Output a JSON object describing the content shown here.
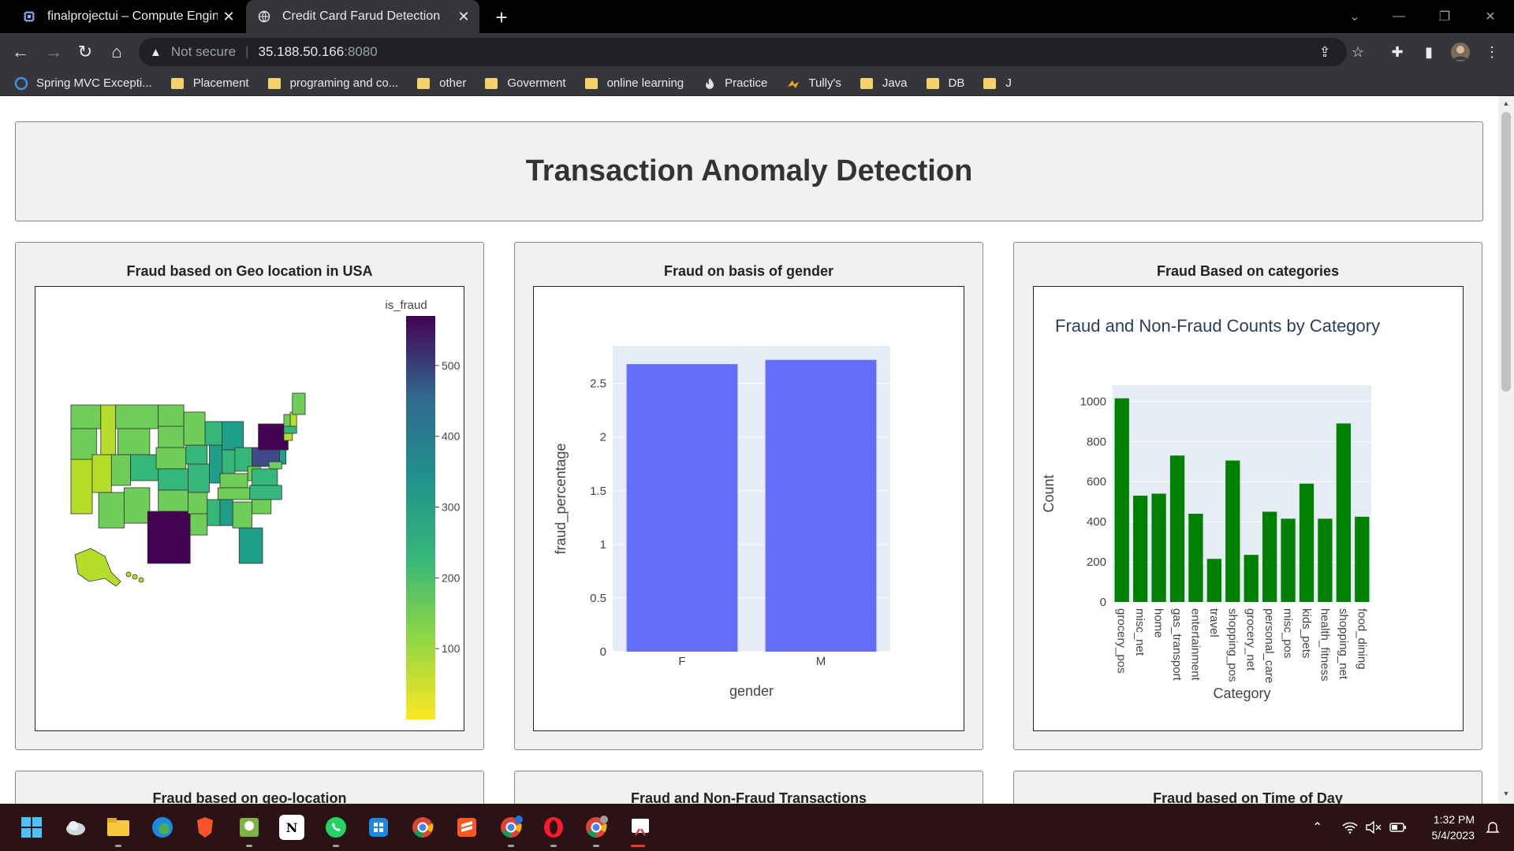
{
  "browser": {
    "tabs": [
      {
        "title": "finalprojectui – Compute Engine",
        "active": false
      },
      {
        "title": "Credit Card Farud Detection",
        "active": true
      }
    ],
    "address": {
      "security": "Not secure",
      "host": "35.188.50.166",
      "port": ":8080"
    },
    "bookmarks": [
      "Spring MVC Excepti...",
      "Placement",
      "programing and co...",
      "other",
      "Goverment",
      "online learning",
      "Practice",
      "Tully's",
      "Java",
      "DB",
      "J"
    ]
  },
  "page": {
    "heading": "Transaction Anomaly Detection",
    "cards": {
      "geo_title": "Fraud based on Geo location in USA",
      "gender_title": "Fraud on basis of gender",
      "category_title": "Fraud Based on categories",
      "bottom": [
        "Fraud based on geo-location",
        "Fraud and Non-Fraud Transactions",
        "Fraud based on Time of Day"
      ]
    }
  },
  "chart_data": [
    {
      "type": "choropleth",
      "colorbar_title": "is_fraud",
      "colorbar_ticks": [
        100,
        200,
        300,
        400,
        500
      ],
      "range": [
        0,
        570
      ],
      "colorscale": "Viridis (reversed)",
      "highlights": {
        "TX": 560,
        "NY": 560,
        "PA": 420,
        "CA": 40
      }
    },
    {
      "type": "bar",
      "categories": [
        "F",
        "M"
      ],
      "values": [
        2.68,
        2.72
      ],
      "xlabel": "gender",
      "ylabel": "fraud_percentage",
      "yticks": [
        "0",
        "0.5",
        "1",
        "1.5",
        "2",
        "2.5"
      ],
      "ylim": [
        0,
        2.85
      ],
      "color": "#636efa"
    },
    {
      "type": "bar",
      "title": "Fraud and Non-Fraud Counts by Category",
      "categories": [
        "grocery_pos",
        "misc_net",
        "home",
        "gas_transport",
        "entertainment",
        "travel",
        "shopping_pos",
        "grocery_net",
        "personal_care",
        "misc_pos",
        "kids_pets",
        "health_fitness",
        "shopping_net",
        "food_dining"
      ],
      "values": [
        1015,
        530,
        540,
        730,
        440,
        215,
        705,
        235,
        450,
        415,
        590,
        415,
        890,
        425
      ],
      "xlabel": "Category",
      "ylabel": "Count",
      "yticks": [
        0,
        200,
        400,
        600,
        800,
        1000
      ],
      "ylim": [
        0,
        1080
      ],
      "color": "#008000"
    }
  ],
  "taskbar": {
    "time": "1:32 PM",
    "date": "5/4/2023"
  }
}
